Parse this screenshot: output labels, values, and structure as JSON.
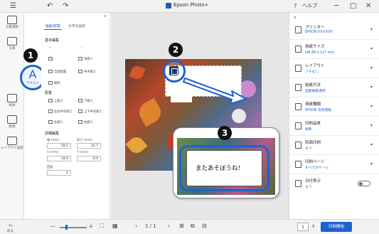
{
  "app": {
    "title": "Epson Photo+",
    "help": "ヘルプ"
  },
  "titlebar": {
    "menu_icon": "hamburger-icon",
    "undo_icon": "undo-icon",
    "redo_icon": "redo-icon",
    "minimize": "─",
    "maximize": "□",
    "close": "✕"
  },
  "sidebar": {
    "items": [
      {
        "label": "写真選択",
        "icon": "photo-select-icon"
      },
      {
        "label": "写真",
        "icon": "photo-icon"
      },
      {
        "label": "テキスト",
        "icon": "text-icon",
        "glyph": "A"
      },
      {
        "label": "削除",
        "icon": "delete-icon"
      },
      {
        "label": "絵柄",
        "icon": "pattern-icon"
      },
      {
        "label": "背景素材",
        "icon": "background-icon"
      },
      {
        "label": "レイアウト設定",
        "icon": "layout-icon"
      }
    ],
    "back_label": "戻る"
  },
  "panel": {
    "tabs": [
      "編集/配置",
      "文字の設定"
    ],
    "section_basic": "基本編集",
    "tools": [
      "前面へ",
      "背面へ",
      "全面配置",
      "中央揃え",
      "削除"
    ],
    "section_align": "配置",
    "align": [
      "上揃え",
      "下揃え",
      "左右中央揃え",
      "上下中央揃え",
      "左揃え",
      "右揃え"
    ],
    "section_detail": "詳細編集",
    "fields": [
      {
        "label": "幅 (mm)",
        "value": "58.5"
      },
      {
        "label": "高さ (mm)",
        "value": "24.7"
      },
      {
        "label": "X (mm)",
        "value": "18.9"
      },
      {
        "label": "Y (mm)",
        "value": "8.9"
      },
      {
        "label": "回転",
        "value": "0"
      }
    ]
  },
  "canvas": {
    "callout_text": "またあそぼうね！"
  },
  "markers": [
    "1",
    "2",
    "3"
  ],
  "rpanel": {
    "items": [
      {
        "label": "プリンター",
        "value": "EPSON XX-XXXX",
        "icon": "printer-icon"
      },
      {
        "label": "用紙サイズ",
        "value": "L判 89 x 127 mm",
        "icon": "paper-size-icon"
      },
      {
        "label": "レイアウト",
        "value": "フチなし",
        "icon": "layout-icon"
      },
      {
        "label": "給紙方法",
        "value": "自動給紙選択",
        "icon": "paper-feed-icon"
      },
      {
        "label": "用紙種類",
        "value": "EPSON 写真用紙",
        "icon": "paper-type-icon"
      },
      {
        "label": "印刷品質",
        "value": "標準",
        "icon": "quality-icon"
      },
      {
        "label": "両面印刷",
        "value": "オフ",
        "icon": "duplex-icon"
      },
      {
        "label": "印刷ページ",
        "value": "すべてのページ",
        "icon": "pages-icon"
      },
      {
        "label": "日付表示",
        "value": "オフ",
        "icon": "date-icon"
      }
    ]
  },
  "bottombar": {
    "page": "1 / 1",
    "copies": "1",
    "print_label": "印刷開始",
    "zoom_out": "－",
    "zoom_in": "＋"
  }
}
